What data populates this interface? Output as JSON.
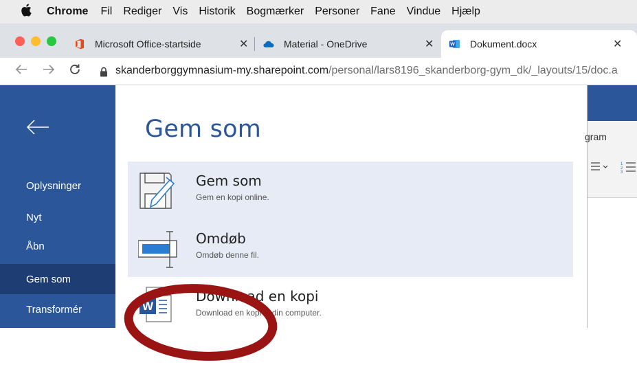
{
  "menubar": {
    "apple": "",
    "items": [
      "Chrome",
      "Fil",
      "Rediger",
      "Vis",
      "Historik",
      "Bogmærker",
      "Personer",
      "Fane",
      "Vindue",
      "Hjælp"
    ]
  },
  "tabs": [
    {
      "label": "Microsoft Office-startside",
      "close": "✕",
      "icon": "office-icon"
    },
    {
      "label": "Material - OneDrive",
      "close": "✕",
      "icon": "onedrive-icon"
    },
    {
      "label": "Dokument.docx",
      "close": "✕",
      "icon": "word-icon"
    }
  ],
  "address": {
    "host": "skanderborggymnasium-my.sharepoint.com",
    "path": "/personal/lars8196_skanderborg-gym_dk/_layouts/15/doc.a"
  },
  "leftnav": {
    "items": [
      "Oplysninger",
      "Nyt",
      "Åbn",
      "Gem som",
      "Transformér"
    ],
    "selected": "Gem som"
  },
  "panel": {
    "title": "Gem som",
    "options": [
      {
        "title": "Gem som",
        "desc": "Gem en kopi online."
      },
      {
        "title": "Omdøb",
        "desc": "Omdøb denne fil."
      },
      {
        "title": "Download en kopi",
        "desc": "Download en kopi til din computer."
      }
    ]
  },
  "doc": {
    "ribbon_label": "gram"
  },
  "colors": {
    "word_blue": "#2b579a",
    "nav_selected": "#1d3d73",
    "highlight": "#e6ebf5",
    "annotation_red": "#9b1414"
  }
}
